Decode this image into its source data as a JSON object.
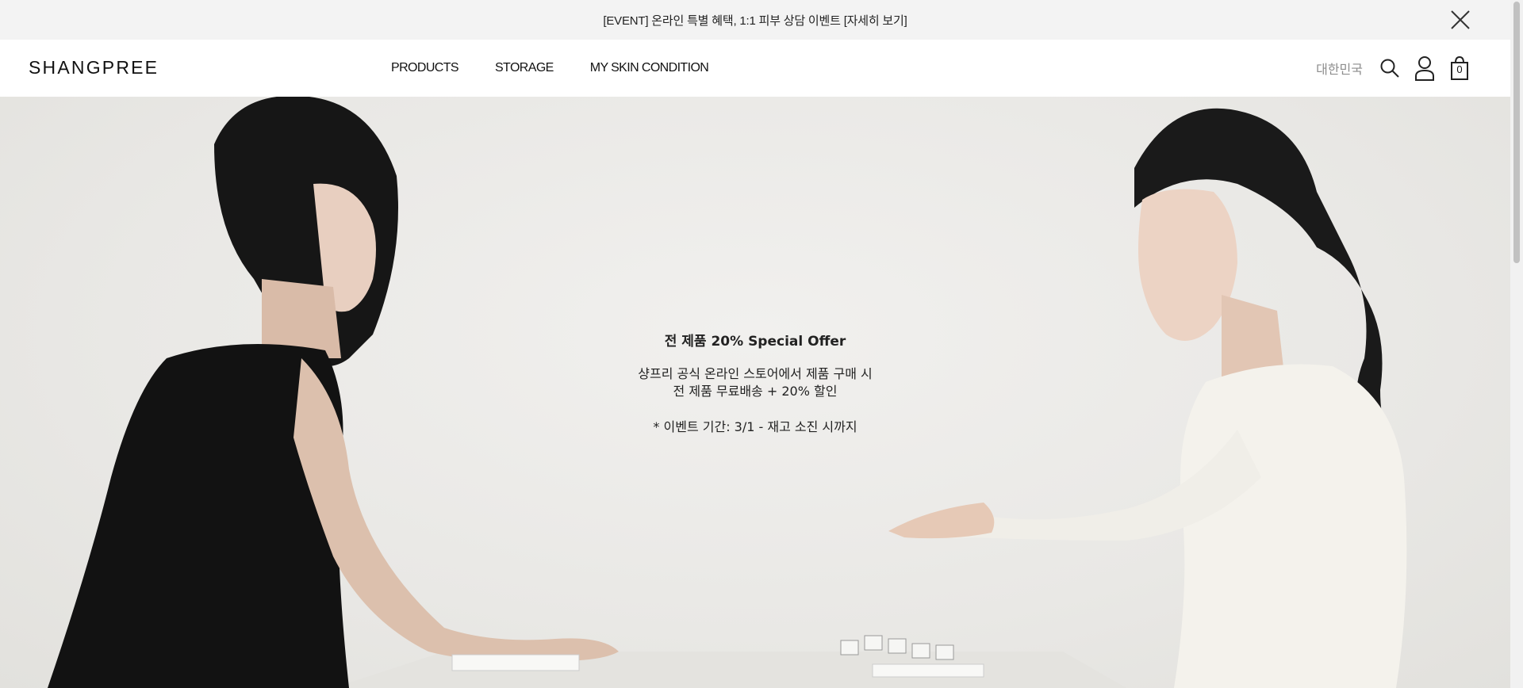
{
  "announcement": {
    "text": "[EVENT] 온라인 특별 혜택, 1:1 피부 상담 이벤트 [자세히 보기]",
    "close_icon": "close-icon"
  },
  "header": {
    "logo": "SHANGPREE",
    "nav": [
      "PRODUCTS",
      "STORAGE",
      "MY SKIN CONDITION"
    ],
    "language": "대한민국",
    "icons": [
      "search-icon",
      "user-icon",
      "cart-icon"
    ],
    "cart_count": "0"
  },
  "hero": {
    "title": "전 제품 20% Special Offer",
    "line1": "샹프리 공식 온라인 스토어에서 제품 구매 시",
    "line2": "전 제품 무료배송 + 20% 할인",
    "note": "* 이벤트 기간: 3/1 - 재고 소진 시까지"
  },
  "colors": {
    "topbar_bg": "#f3f3f3",
    "text": "#111111",
    "language_text": "#8d8d8d",
    "hero_bg": "#e9e8e5"
  }
}
